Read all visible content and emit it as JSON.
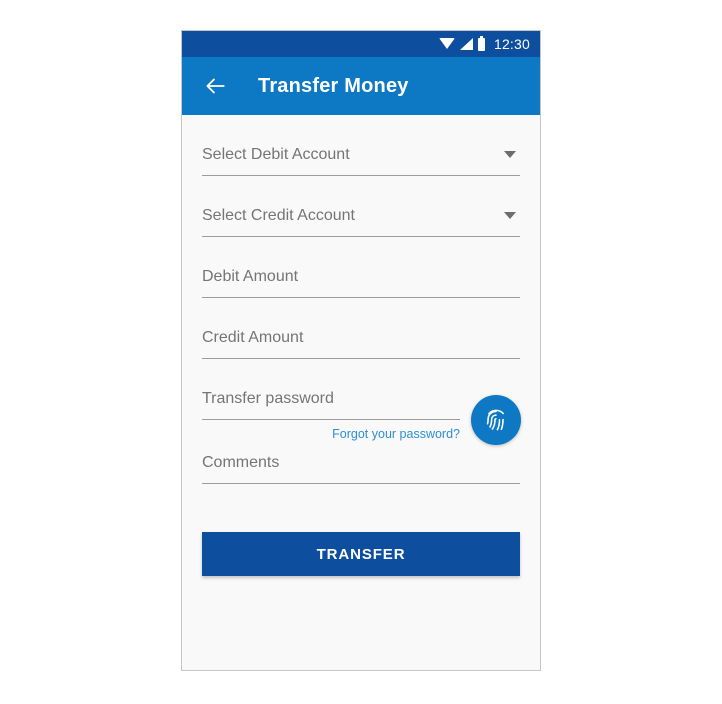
{
  "status_bar": {
    "time": "12:30",
    "icons": [
      "wifi-icon",
      "signal-icon",
      "battery-icon"
    ],
    "background": "#0d4e9e"
  },
  "app_bar": {
    "title": "Transfer Money",
    "back_icon": "back-arrow-icon",
    "background": "#0d79c4"
  },
  "form": {
    "debit_account": {
      "label": "Select Debit Account",
      "value": "",
      "type": "dropdown"
    },
    "credit_account": {
      "label": "Select Credit Account",
      "value": "",
      "type": "dropdown"
    },
    "debit_amount": {
      "label": "Debit Amount",
      "value": ""
    },
    "credit_amount": {
      "label": "Credit Amount",
      "value": ""
    },
    "transfer_password": {
      "label": "Transfer password",
      "value": ""
    },
    "forgot_password_link": "Forgot your password?",
    "fingerprint_icon": "fingerprint-icon",
    "comments": {
      "label": "Comments",
      "value": ""
    }
  },
  "actions": {
    "transfer_label": "TRANSFER"
  },
  "colors": {
    "status_bar_blue": "#0d4e9e",
    "app_bar_blue": "#0d79c4",
    "primary_button_blue": "#0d4e9e",
    "link_blue": "#2d8fd5",
    "placeholder_gray": "#757575",
    "underline_gray": "#9b9b9b",
    "content_background": "#f9f9f9"
  }
}
